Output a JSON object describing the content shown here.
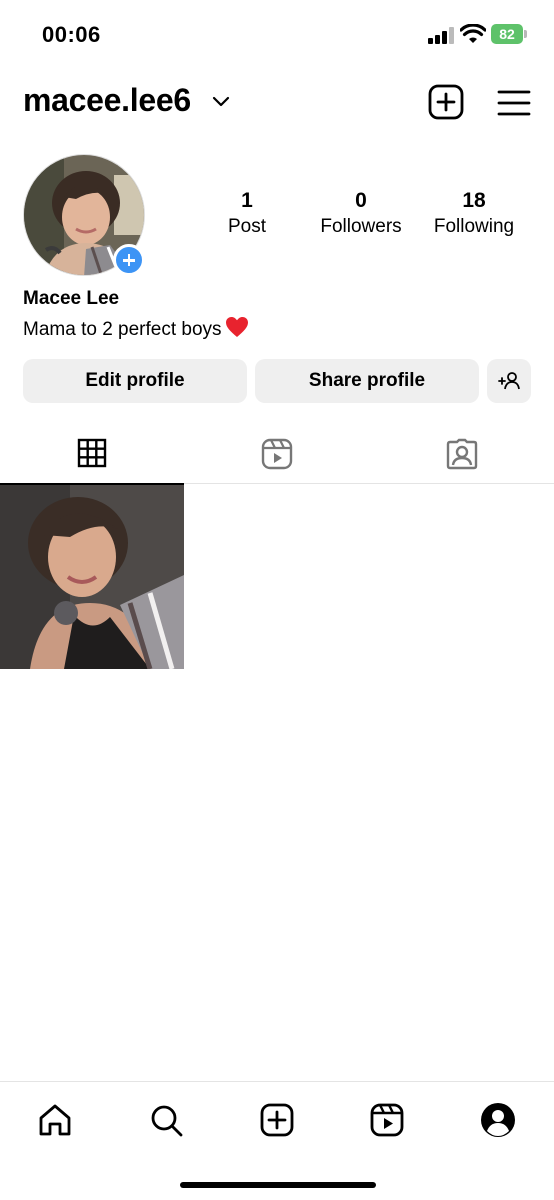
{
  "status_bar": {
    "time": "00:06",
    "battery": "82",
    "icons": [
      "cellular-signal-icon",
      "wifi-icon",
      "battery-charging-icon"
    ]
  },
  "header": {
    "username": "macee.lee6",
    "icons": [
      "chevron-down-icon",
      "create-post-icon",
      "menu-icon"
    ]
  },
  "profile": {
    "stats": [
      {
        "value": "1",
        "label": "Post"
      },
      {
        "value": "0",
        "label": "Followers"
      },
      {
        "value": "18",
        "label": "Following"
      }
    ],
    "display_name": "Macee Lee",
    "bio": "Mama to 2 perfect boys",
    "bio_emoji": "heart-icon"
  },
  "actions": {
    "edit_label": "Edit profile",
    "share_label": "Share profile",
    "add_user_icon": "add-user-icon"
  },
  "tabs": [
    {
      "icon": "grid-icon",
      "active": true
    },
    {
      "icon": "reels-icon",
      "active": false
    },
    {
      "icon": "tagged-icon",
      "active": false
    }
  ],
  "posts_count": 1,
  "bottom_nav": [
    "home-icon",
    "search-icon",
    "create-icon",
    "reels-icon",
    "profile-icon"
  ],
  "colors": {
    "accent_blue": "#3d94f5",
    "button_bg": "#efefef",
    "battery_green": "#5ec26a",
    "heart_red": "#e8232e"
  }
}
